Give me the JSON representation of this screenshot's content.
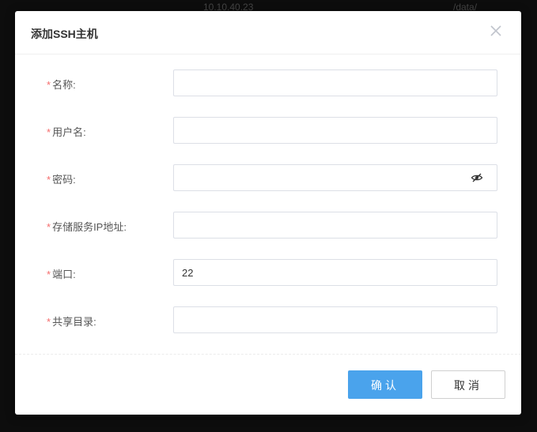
{
  "background": {
    "ip": "10.10.40.23",
    "path": "/data/"
  },
  "dialog": {
    "title": "添加SSH主机",
    "close_icon": "close-icon",
    "required_mark": "*",
    "fields": [
      {
        "label": "名称:",
        "value": "",
        "type": "text"
      },
      {
        "label": "用户名:",
        "value": "",
        "type": "text"
      },
      {
        "label": "密码:",
        "value": "",
        "type": "password",
        "icon": "eye-hidden-icon"
      },
      {
        "label": "存储服务IP地址:",
        "value": "",
        "type": "text"
      },
      {
        "label": "端口:",
        "value": "22",
        "type": "text"
      },
      {
        "label": "共享目录:",
        "value": "",
        "type": "text"
      }
    ],
    "buttons": {
      "confirm": "确认",
      "cancel": "取消"
    },
    "colors": {
      "primary": "#4aa3ec",
      "required": "#f56c6c"
    }
  }
}
